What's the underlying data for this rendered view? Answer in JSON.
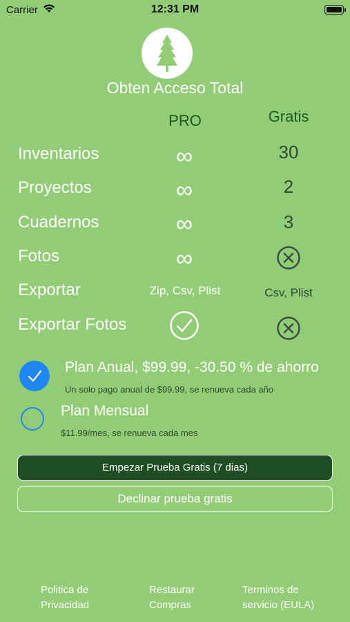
{
  "status_bar": {
    "carrier": "Carrier",
    "time": "12:31 PM"
  },
  "header": {
    "title": "Obten Acceso Total"
  },
  "table": {
    "columns": [
      "PRO",
      "Gratis"
    ],
    "rows": [
      {
        "label": "Inventarios",
        "pro": "∞",
        "free": "30"
      },
      {
        "label": "Proyectos",
        "pro": "∞",
        "free": "2"
      },
      {
        "label": "Cuadernos",
        "pro": "∞",
        "free": "3"
      },
      {
        "label": "Fotos",
        "pro": "∞",
        "free_icon": "x-circle-icon"
      },
      {
        "label": "Exportar",
        "pro": "Zip, Csv, Plist",
        "free": "Csv, Plist"
      },
      {
        "label": "Exportar Fotos",
        "pro_icon": "check-circle-icon",
        "free_icon": "x-circle-icon"
      }
    ]
  },
  "plans": [
    {
      "title": "Plan Anual, $99.99, -30.50 % de ahorro",
      "subtitle": "Un solo pago anual de $99.99, se renueva cada año",
      "selected": true
    },
    {
      "title": "Plan Mensual",
      "subtitle": "$11.99/mes, se renueva cada mes",
      "selected": false
    }
  ],
  "buttons": {
    "start_trial": "Empezar Prueba Gratis (7 dias)",
    "decline_trial": "Declinar prueba gratis"
  },
  "footer": {
    "privacy": [
      "Politica de",
      "Privacidad"
    ],
    "restore": [
      "Restaurar",
      "Compras"
    ],
    "terms": [
      "Terminos de",
      "servicio (EULA)"
    ]
  },
  "colors": {
    "background": "#93cc76",
    "primary_button": "#1f4d24",
    "radio_accent": "#1e88f0",
    "column_header": "#1d5a22"
  }
}
